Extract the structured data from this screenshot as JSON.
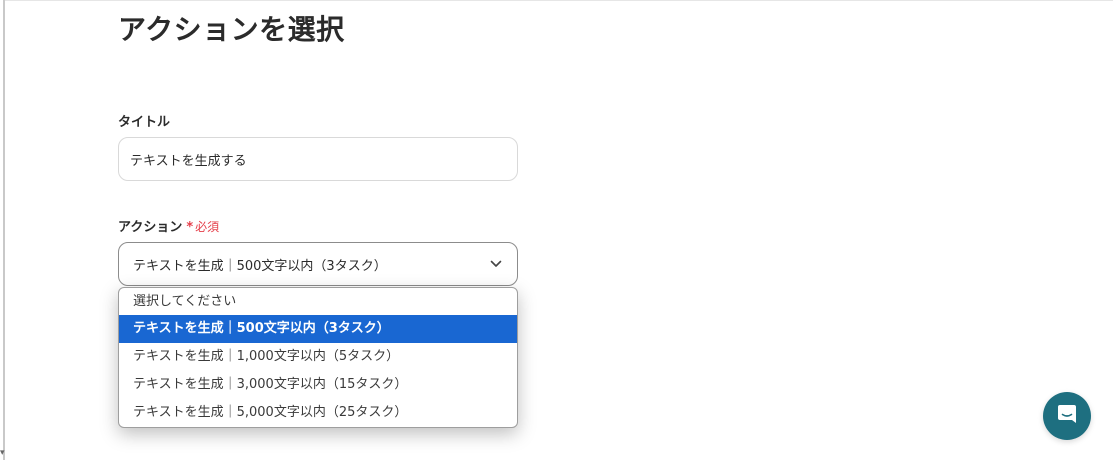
{
  "page": {
    "title": "アクションを選択"
  },
  "title_field": {
    "label": "タイトル",
    "value": "テキストを生成する"
  },
  "action_field": {
    "label": "アクション",
    "required_mark": "*",
    "required_text": "必須",
    "selected_value": "テキストを生成｜500文字以内（3タスク）"
  },
  "dropdown": {
    "options": [
      {
        "label": "選択してください",
        "selected": false
      },
      {
        "label": "テキストを生成｜500文字以内（3タスク）",
        "selected": true
      },
      {
        "label": "テキストを生成｜1,000文字以内（5タスク）",
        "selected": false
      },
      {
        "label": "テキストを生成｜3,000文字以内（15タスク）",
        "selected": false
      },
      {
        "label": "テキストを生成｜5,000文字以内（25タスク）",
        "selected": false
      }
    ]
  },
  "icons": {
    "select_chevron": "chevron-down-icon",
    "chat": "chat-bubble-icon"
  },
  "colors": {
    "required": "#e53e4a",
    "selected_option_bg": "#1967d2",
    "chat_button_bg": "#1e6f80"
  }
}
